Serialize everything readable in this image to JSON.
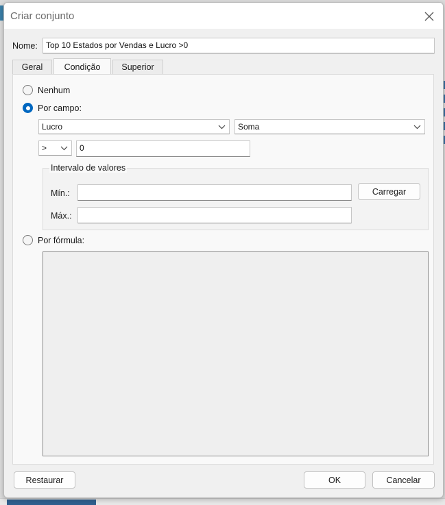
{
  "dialog": {
    "title": "Criar conjunto",
    "name_label": "Nome:",
    "name_value": "Top 10 Estados por Vendas e Lucro >0"
  },
  "tabs": [
    {
      "label": "Geral",
      "active": false
    },
    {
      "label": "Condição",
      "active": true
    },
    {
      "label": "Superior",
      "active": false
    }
  ],
  "condition": {
    "none_label": "Nenhum",
    "by_field_label": "Por campo:",
    "field_select": "Lucro",
    "aggregation_select": "Soma",
    "operator_select": ">",
    "value_input": "0",
    "range_group_label": "Intervalo de valores",
    "min_label": "Mín.:",
    "min_value": "",
    "max_label": "Máx.:",
    "max_value": "",
    "load_button": "Carregar",
    "by_formula_label": "Por fórmula:",
    "formula_text": "",
    "selected": "by_field"
  },
  "footer": {
    "reset_button": "Restaurar",
    "ok_button": "OK",
    "cancel_button": "Cancelar"
  },
  "colors": {
    "accent": "#0067c0"
  }
}
